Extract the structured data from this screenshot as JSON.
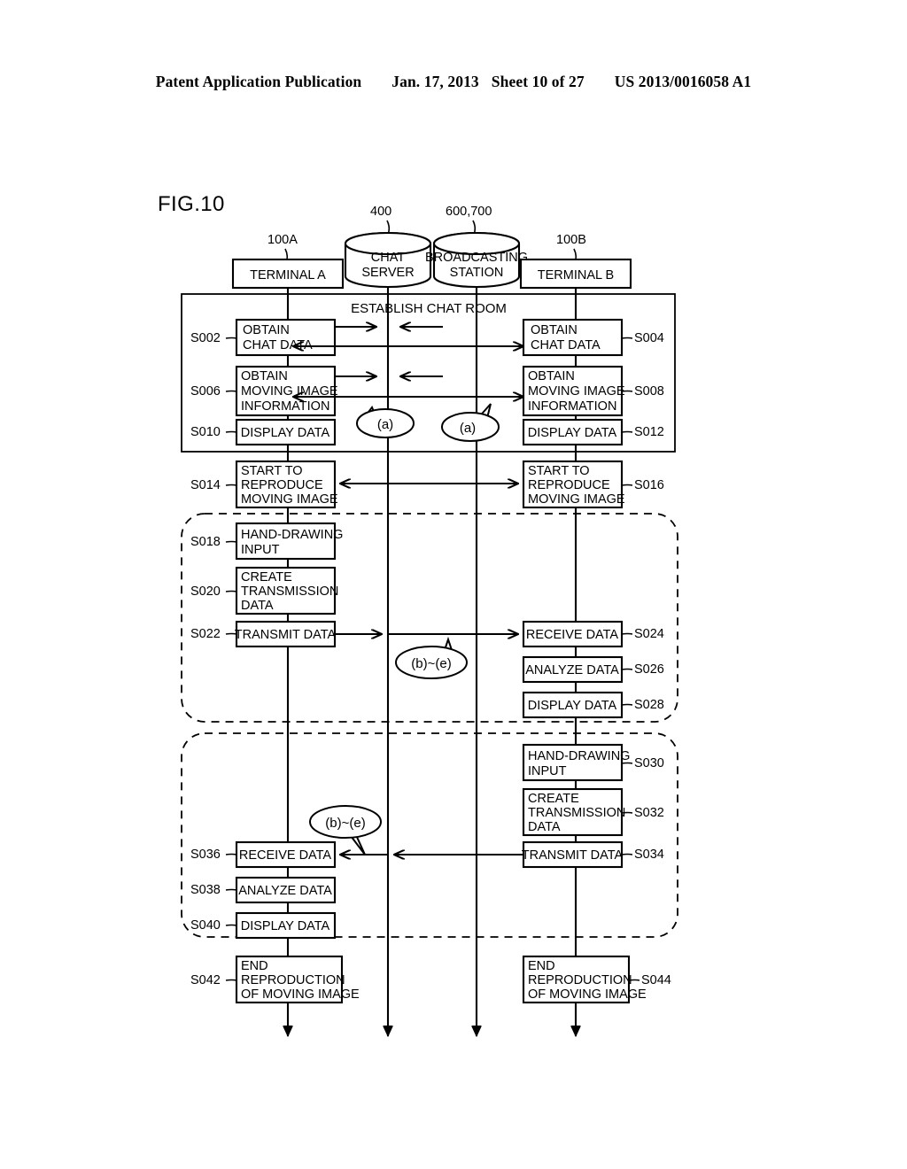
{
  "header": {
    "publication": "Patent Application Publication",
    "date": "Jan. 17, 2013",
    "sheet": "Sheet 10 of 27",
    "doc_number": "US 2013/0016058 A1"
  },
  "figure": {
    "title": "FIG.10",
    "section_label": "ESTABLISH CHAT ROOM"
  },
  "actors": [
    {
      "id": "terminal-a",
      "label": "TERMINAL A",
      "ref": "100A",
      "shape": "rect"
    },
    {
      "id": "chat-server",
      "label_line1": "CHAT",
      "label_line2": "SERVER",
      "ref": "400",
      "shape": "cylinder"
    },
    {
      "id": "broadcasting-station",
      "label_line1": "BROADCASTING",
      "label_line2": "STATION",
      "ref": "600,700",
      "shape": "cylinder"
    },
    {
      "id": "terminal-b",
      "label": "TERMINAL B",
      "ref": "100B",
      "shape": "rect"
    }
  ],
  "steps": {
    "s002": {
      "id": "S002",
      "lines": [
        "OBTAIN",
        "CHAT DATA"
      ]
    },
    "s004": {
      "id": "S004",
      "lines": [
        "OBTAIN",
        "CHAT DATA"
      ]
    },
    "s006": {
      "id": "S006",
      "lines": [
        "OBTAIN",
        "MOVING IMAGE",
        "INFORMATION"
      ]
    },
    "s008": {
      "id": "S008",
      "lines": [
        "OBTAIN",
        "MOVING IMAGE",
        "INFORMATION"
      ]
    },
    "s010": {
      "id": "S010",
      "lines": [
        "DISPLAY DATA"
      ]
    },
    "s012": {
      "id": "S012",
      "lines": [
        "DISPLAY DATA"
      ]
    },
    "s014": {
      "id": "S014",
      "lines": [
        "START TO",
        "REPRODUCE",
        "MOVING IMAGE"
      ]
    },
    "s016": {
      "id": "S016",
      "lines": [
        "START TO",
        "REPRODUCE",
        "MOVING IMAGE"
      ]
    },
    "s018": {
      "id": "S018",
      "lines": [
        "HAND-DRAWING",
        "INPUT"
      ]
    },
    "s020": {
      "id": "S020",
      "lines": [
        "CREATE",
        "TRANSMISSION",
        "DATA"
      ]
    },
    "s022": {
      "id": "S022",
      "lines": [
        "TRANSMIT DATA"
      ]
    },
    "s024": {
      "id": "S024",
      "lines": [
        "RECEIVE DATA"
      ]
    },
    "s026": {
      "id": "S026",
      "lines": [
        "ANALYZE DATA"
      ]
    },
    "s028": {
      "id": "S028",
      "lines": [
        "DISPLAY DATA"
      ]
    },
    "s030": {
      "id": "S030",
      "lines": [
        "HAND-DRAWING",
        "INPUT"
      ]
    },
    "s032": {
      "id": "S032",
      "lines": [
        "CREATE",
        "TRANSMISSION",
        "DATA"
      ]
    },
    "s034": {
      "id": "S034",
      "lines": [
        "TRANSMIT DATA"
      ]
    },
    "s036": {
      "id": "S036",
      "lines": [
        "RECEIVE DATA"
      ]
    },
    "s038": {
      "id": "S038",
      "lines": [
        "ANALYZE DATA"
      ]
    },
    "s040": {
      "id": "S040",
      "lines": [
        "DISPLAY DATA"
      ]
    },
    "s042": {
      "id": "S042",
      "lines": [
        "END",
        "REPRODUCTION",
        "OF MOVING IMAGE"
      ]
    },
    "s044": {
      "id": "S044",
      "lines": [
        "END",
        "REPRODUCTION",
        "OF MOVING IMAGE"
      ]
    }
  },
  "callouts": {
    "a1": "(a)",
    "a2": "(a)",
    "be1": "(b)~(e)",
    "be2": "(b)~(e)"
  }
}
